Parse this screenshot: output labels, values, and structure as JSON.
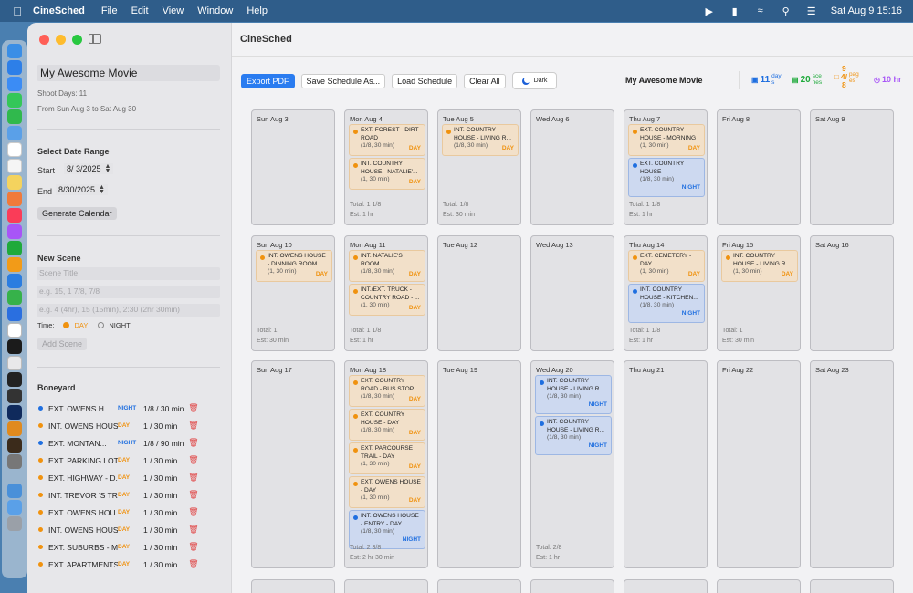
{
  "menubar": {
    "app": "CineSched",
    "items": [
      "File",
      "Edit",
      "View",
      "Window",
      "Help"
    ],
    "clock": "Sat Aug 9  15:16"
  },
  "sidebar": {
    "title_value": "My Awesome Movie",
    "shoot_days": "Shoot Days: 11",
    "range_text": "From Sun Aug 3 to Sat Aug 30",
    "date_range_header": "Select Date Range",
    "start_label": "Start",
    "start_value": "8/  3/2025",
    "end_label": "End",
    "end_value": "8/30/2025",
    "generate_button": "Generate Calendar",
    "new_scene_header": "New Scene",
    "scene_title_placeholder": "Scene Title",
    "pages_placeholder": "e.g. 15, 1 7/8, 7/8",
    "duration_placeholder": "e.g. 4 (4hr), 15 (15min), 2:30 (2hr 30min)",
    "time_label": "Time:",
    "day_option": "DAY",
    "night_option": "NIGHT",
    "add_scene_button": "Add Scene",
    "boneyard_header": "Boneyard",
    "boneyard": [
      {
        "name": "EXT. OWENS H...",
        "tod": "NIGHT",
        "pages": "1/8 / 30 min"
      },
      {
        "name": "INT. OWENS HOUS...",
        "tod": "DAY",
        "pages": "1 / 30 min"
      },
      {
        "name": "EXT. MONTAN...",
        "tod": "NIGHT",
        "pages": "1/8 / 90 min"
      },
      {
        "name": "EXT. PARKING LOT...",
        "tod": "DAY",
        "pages": "1 / 30 min"
      },
      {
        "name": "EXT. HIGHWAY - D...",
        "tod": "DAY",
        "pages": "1 / 30 min"
      },
      {
        "name": "INT. TREVOR 'S TR...",
        "tod": "DAY",
        "pages": "1 / 30 min"
      },
      {
        "name": "EXT. OWENS HOU...",
        "tod": "DAY",
        "pages": "1 / 30 min"
      },
      {
        "name": "INT. OWENS HOUS...",
        "tod": "DAY",
        "pages": "1 / 30 min"
      },
      {
        "name": "EXT. SUBURBS - M...",
        "tod": "DAY",
        "pages": "1 / 30 min"
      },
      {
        "name": "EXT. APARTMENTS...",
        "tod": "DAY",
        "pages": "1 / 30 min"
      }
    ]
  },
  "main": {
    "window_title": "CineSched",
    "export_pdf": "Export PDF",
    "save_as": "Save Schedule As...",
    "load": "Load Schedule",
    "clear": "Clear All",
    "theme": "Dark",
    "movie_name": "My Awesome Movie",
    "stats": {
      "days_value": "11",
      "days_label_1": "day",
      "days_label_2": "s",
      "scenes_value": "20",
      "scenes_label_1": "sce",
      "scenes_label_2": "nes",
      "pages_top": "9",
      "pages_value": "4/",
      "pages_bottom": "8",
      "pages_label_1": "pag",
      "pages_label_2": "es",
      "hours_value": "10 hr"
    }
  },
  "colors": {
    "day": "#f0920f",
    "night": "#1f6fe0",
    "accent": "#2a7cf0",
    "delete": "#e04040"
  },
  "calendar": {
    "weeks": [
      [
        {
          "date": "Sun Aug 3",
          "scenes": [],
          "total": "",
          "est": ""
        },
        {
          "date": "Mon Aug 4",
          "scenes": [
            {
              "title": "EXT. FOREST - DIRT ROAD",
              "meta": "(1/8, 30 min)",
              "tod": "DAY"
            },
            {
              "title": "INT. COUNTRY HOUSE - NATALIE'...",
              "meta": "(1, 30 min)",
              "tod": "DAY"
            }
          ],
          "total": "Total: 1 1/8",
          "est": "Est: 1 hr"
        },
        {
          "date": "Tue Aug 5",
          "scenes": [
            {
              "title": "INT. COUNTRY HOUSE - LIVING R...",
              "meta": "(1/8, 30 min)",
              "tod": "DAY"
            }
          ],
          "total": "Total: 1/8",
          "est": "Est: 30 min"
        },
        {
          "date": "Wed Aug 6",
          "scenes": [],
          "total": "",
          "est": ""
        },
        {
          "date": "Thu Aug 7",
          "scenes": [
            {
              "title": "EXT. COUNTRY HOUSE - MORNING",
              "meta": "(1, 30 min)",
              "tod": "DAY"
            },
            {
              "title": "EXT. COUNTRY HOUSE",
              "meta": "(1/8, 30 min)",
              "tod": "NIGHT"
            }
          ],
          "total": "Total: 1 1/8",
          "est": "Est: 1 hr"
        },
        {
          "date": "Fri Aug 8",
          "scenes": [],
          "total": "",
          "est": ""
        },
        {
          "date": "Sat Aug 9",
          "scenes": [],
          "total": "",
          "est": ""
        }
      ],
      [
        {
          "date": "Sun Aug 10",
          "scenes": [
            {
              "title": "INT. OWENS HOUSE - DINNING ROOM...",
              "meta": "(1, 30 min)",
              "tod": "DAY"
            }
          ],
          "total": "Total: 1",
          "est": "Est: 30 min"
        },
        {
          "date": "Mon Aug 11",
          "scenes": [
            {
              "title": "INT. NATALIE'S ROOM",
              "meta": "(1/8, 30 min)",
              "tod": "DAY"
            },
            {
              "title": "INT./EXT. TRUCK - COUNTRY ROAD - ...",
              "meta": "(1, 30 min)",
              "tod": "DAY"
            }
          ],
          "total": "Total: 1 1/8",
          "est": "Est: 1 hr"
        },
        {
          "date": "Tue Aug 12",
          "scenes": [],
          "total": "",
          "est": ""
        },
        {
          "date": "Wed Aug 13",
          "scenes": [],
          "total": "",
          "est": ""
        },
        {
          "date": "Thu Aug 14",
          "scenes": [
            {
              "title": "EXT. CEMETERY - DAY",
              "meta": "(1, 30 min)",
              "tod": "DAY"
            },
            {
              "title": "INT. COUNTRY HOUSE - KITCHEN...",
              "meta": "(1/8, 30 min)",
              "tod": "NIGHT"
            }
          ],
          "total": "Total: 1 1/8",
          "est": "Est: 1 hr"
        },
        {
          "date": "Fri Aug 15",
          "scenes": [
            {
              "title": "INT. COUNTRY HOUSE - LIVING R...",
              "meta": "(1, 30 min)",
              "tod": "DAY"
            }
          ],
          "total": "Total: 1",
          "est": "Est: 30 min"
        },
        {
          "date": "Sat Aug 16",
          "scenes": [],
          "total": "",
          "est": ""
        }
      ],
      [
        {
          "date": "Sun Aug 17",
          "scenes": [],
          "total": "",
          "est": ""
        },
        {
          "date": "Mon Aug 18",
          "scenes": [
            {
              "title": "EXT. COUNTRY ROAD - BUS STOP...",
              "meta": "(1/8, 30 min)",
              "tod": "DAY"
            },
            {
              "title": "EXT. COUNTRY HOUSE - DAY",
              "meta": "(1/8, 30 min)",
              "tod": "DAY"
            },
            {
              "title": "EXT. PARCOURSE TRAIL - DAY",
              "meta": "(1, 30 min)",
              "tod": "DAY"
            },
            {
              "title": "EXT. OWENS HOUSE - DAY",
              "meta": "(1, 30 min)",
              "tod": "DAY"
            },
            {
              "title": "INT. OWENS HOUSE - ENTRY - DAY",
              "meta": "(1/8, 30 min)",
              "tod": "NIGHT"
            }
          ],
          "total": "Total: 2 3/8",
          "est": "Est: 2 hr 30 min"
        },
        {
          "date": "Tue Aug 19",
          "scenes": [],
          "total": "",
          "est": ""
        },
        {
          "date": "Wed Aug 20",
          "scenes": [
            {
              "title": "INT. COUNTRY HOUSE - LIVING R...",
              "meta": "(1/8, 30 min)",
              "tod": "NIGHT"
            },
            {
              "title": "INT. COUNTRY HOUSE - LIVING R...",
              "meta": "(1/8, 30 min)",
              "tod": "NIGHT"
            }
          ],
          "total": "Total: 2/8",
          "est": "Est: 1 hr"
        },
        {
          "date": "Thu Aug 21",
          "scenes": [],
          "total": "",
          "est": ""
        },
        {
          "date": "Fri Aug 22",
          "scenes": [],
          "total": "",
          "est": ""
        },
        {
          "date": "Sat Aug 23",
          "scenes": [],
          "total": "",
          "est": ""
        }
      ]
    ]
  }
}
